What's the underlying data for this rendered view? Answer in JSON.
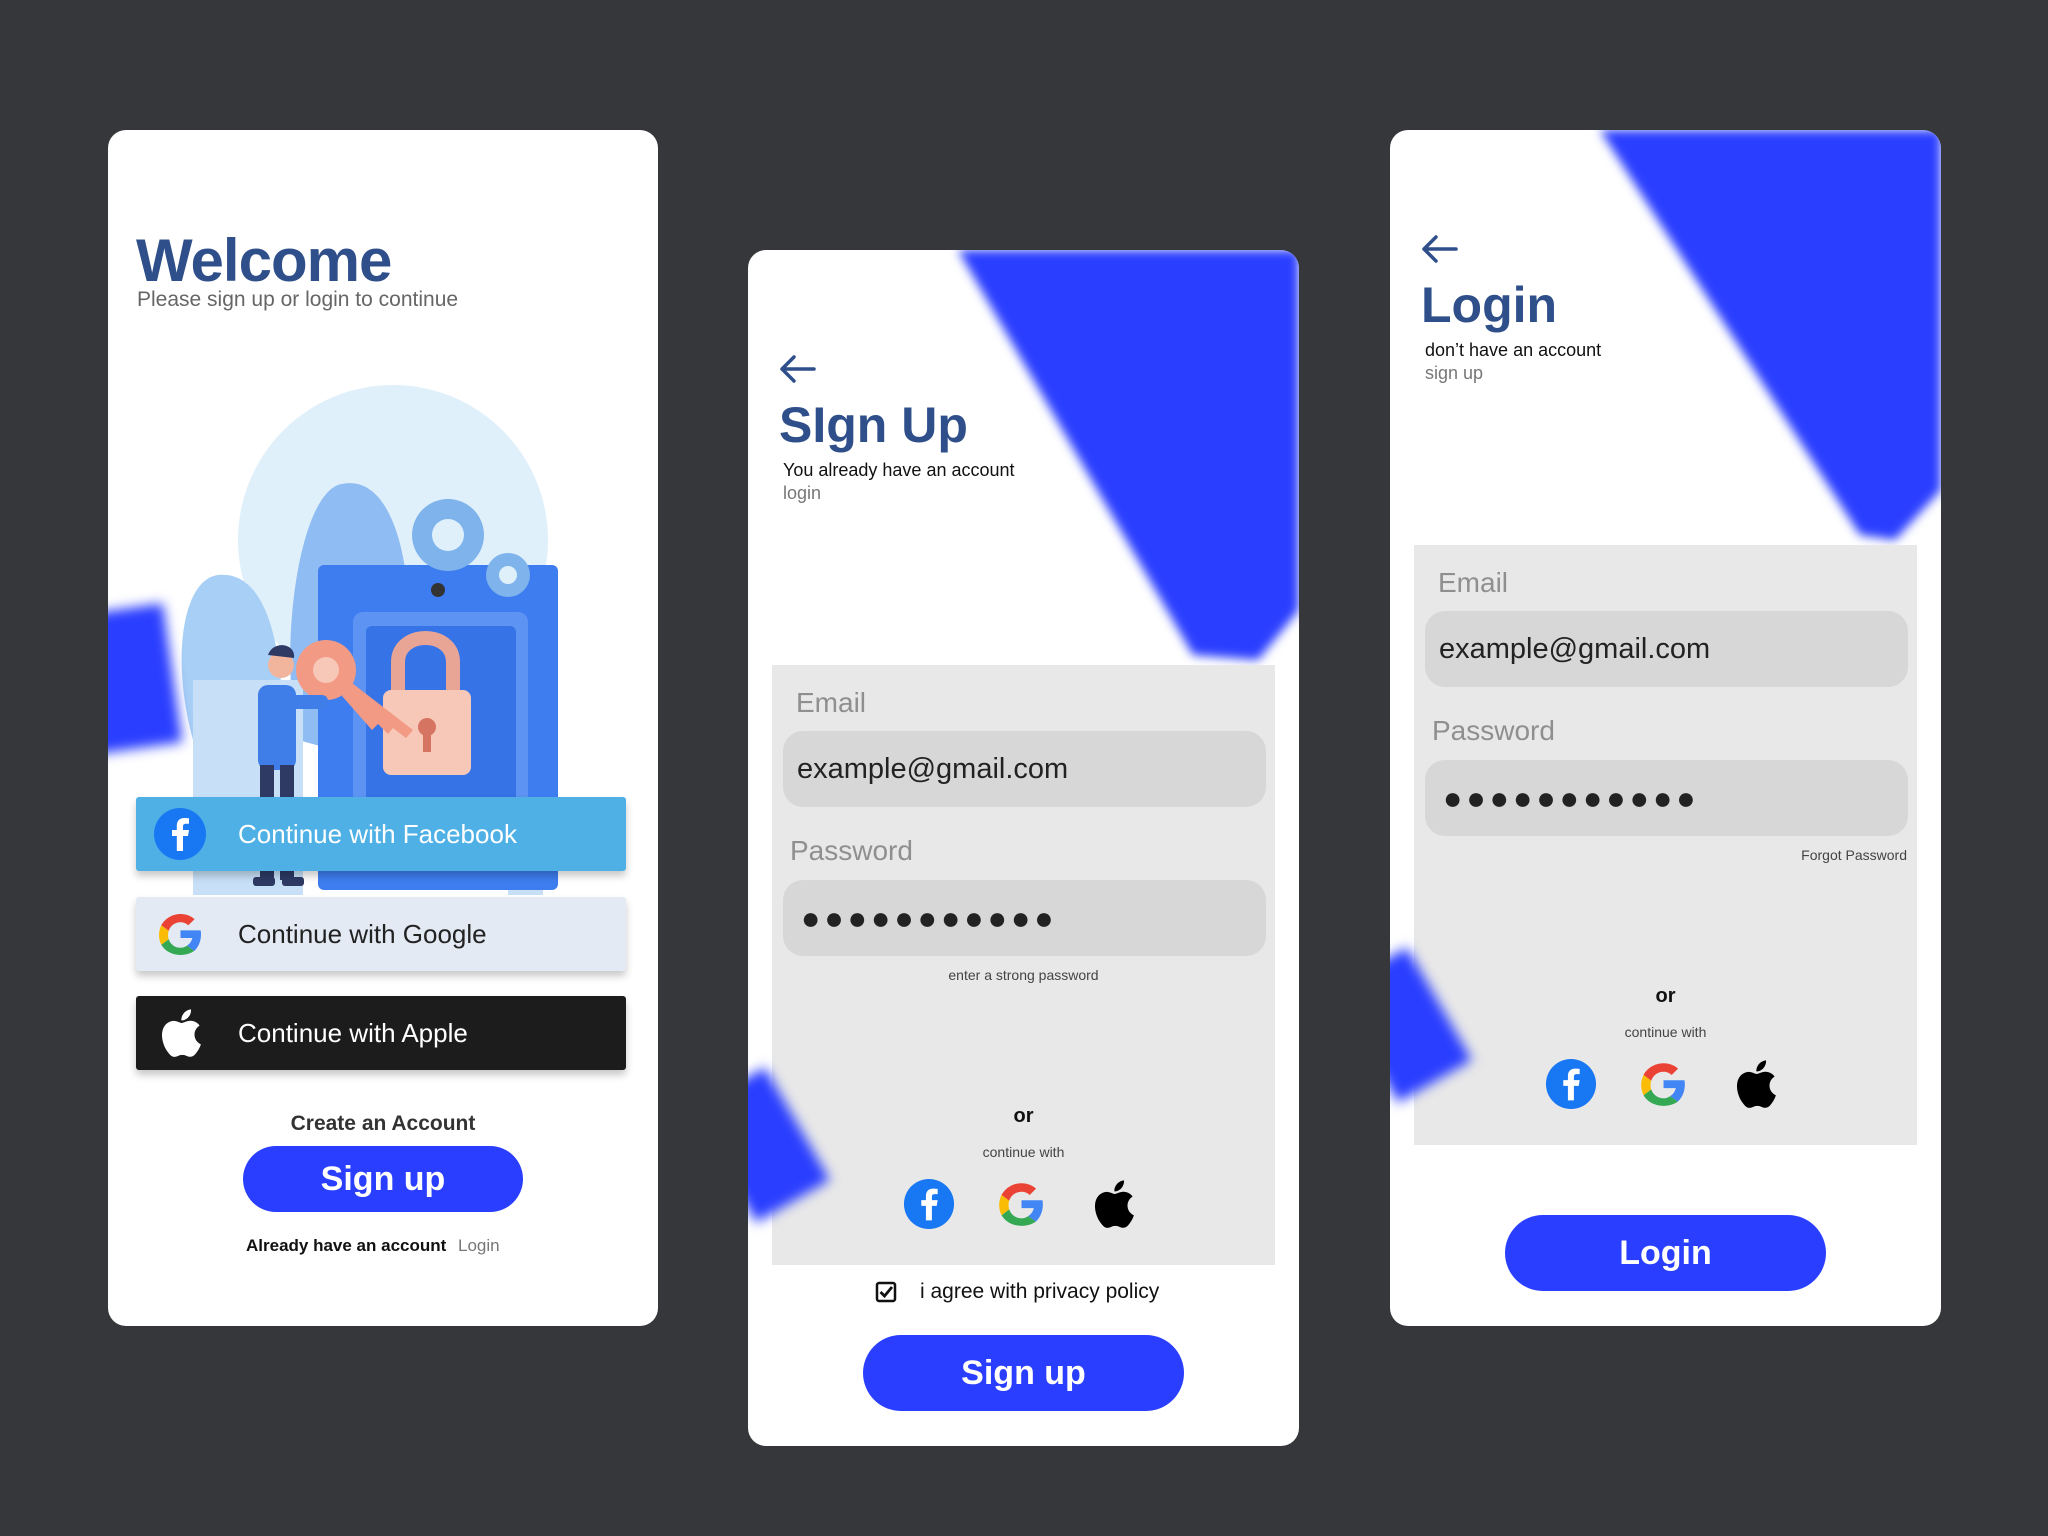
{
  "welcome": {
    "title": "Welcome",
    "subtitle": "Please sign up or login to continue",
    "facebook_label": "Continue with Facebook",
    "google_label": "Continue with Google",
    "apple_label": "Continue with Apple",
    "create_label": "Create an Account",
    "signup_label": "Sign up",
    "already_label": "Already have an account",
    "login_link": "Login"
  },
  "signup": {
    "title": "SIgn Up",
    "subtitle": "You already have an account",
    "login_link": "login",
    "email_label": "Email",
    "email_value": "example@gmail.com",
    "password_label": "Password",
    "password_value": "●●●●●●●●●●●",
    "hint": "enter a strong password",
    "or": "or",
    "continue_with": "continue with",
    "agree_label": "i agree with privacy policy",
    "agree_checked": true,
    "button_label": "Sign up"
  },
  "login": {
    "title": "Login",
    "subtitle": "don’t have an account",
    "signup_link": "sign up",
    "email_label": "Email",
    "email_value": "example@gmail.com",
    "password_label": "Password",
    "password_value": "●●●●●●●●●●●",
    "forgot_label": "Forgot Password",
    "or": "or",
    "continue_with": "continue with",
    "button_label": "Login"
  },
  "icons": [
    "back-arrow-icon",
    "facebook-icon",
    "google-icon",
    "apple-icon",
    "checkbox-icon"
  ],
  "colors": {
    "background": "#36373a",
    "primary_blue": "#2a3eff",
    "title_blue": "#2f4f8a",
    "facebook_blue": "#4fb0e6",
    "google_button": "#e3eaf3",
    "apple_button": "#1c1c1c",
    "panel_gray": "#e8e8e8",
    "field_gray": "#d7d7d7"
  }
}
